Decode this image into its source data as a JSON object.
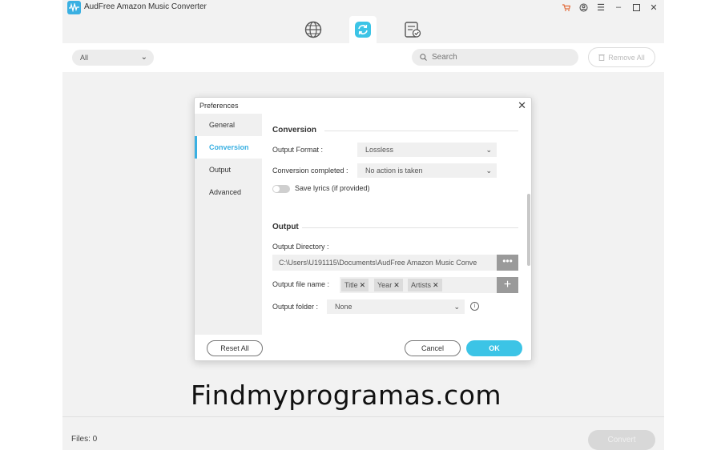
{
  "app": {
    "title": "AudFree Amazon Music Converter",
    "accent_color": "#3ab0e2",
    "window_controls": [
      "cart-icon",
      "account-icon",
      "menu-icon",
      "minimize-icon",
      "maximize-icon",
      "close-icon"
    ]
  },
  "top_tabs": [
    {
      "icon": "globe-icon",
      "active": false
    },
    {
      "icon": "convert-icon",
      "active": true
    },
    {
      "icon": "converted-list-icon",
      "active": false
    }
  ],
  "toolbar": {
    "filter_value": "All",
    "search_placeholder": "Search",
    "remove_all_label": "Remove All"
  },
  "status": {
    "files_label": "Files: 0",
    "convert_label": "Convert"
  },
  "dialog": {
    "title": "Preferences",
    "sidebar": [
      {
        "label": "General",
        "active": false
      },
      {
        "label": "Conversion",
        "active": true
      },
      {
        "label": "Output",
        "active": false
      },
      {
        "label": "Advanced",
        "active": false
      }
    ],
    "conversion": {
      "heading": "Conversion",
      "output_format_label": "Output Format :",
      "output_format_value": "Lossless",
      "conversion_completed_label": "Conversion completed :",
      "conversion_completed_value": "No action is taken",
      "save_lyrics_label": "Save lyrics (if provided)"
    },
    "output": {
      "heading": "Output",
      "directory_label": "Output Directory :",
      "directory_value": "C:\\Users\\U191115\\Documents\\AudFree Amazon Music Conve",
      "file_name_label": "Output file name :",
      "file_name_tags": [
        "Title",
        "Year",
        "Artists"
      ],
      "folder_label": "Output folder :",
      "folder_value": "None"
    },
    "buttons": {
      "reset": "Reset All",
      "cancel": "Cancel",
      "ok": "OK"
    }
  },
  "watermark": "Findmyprogramas.com"
}
